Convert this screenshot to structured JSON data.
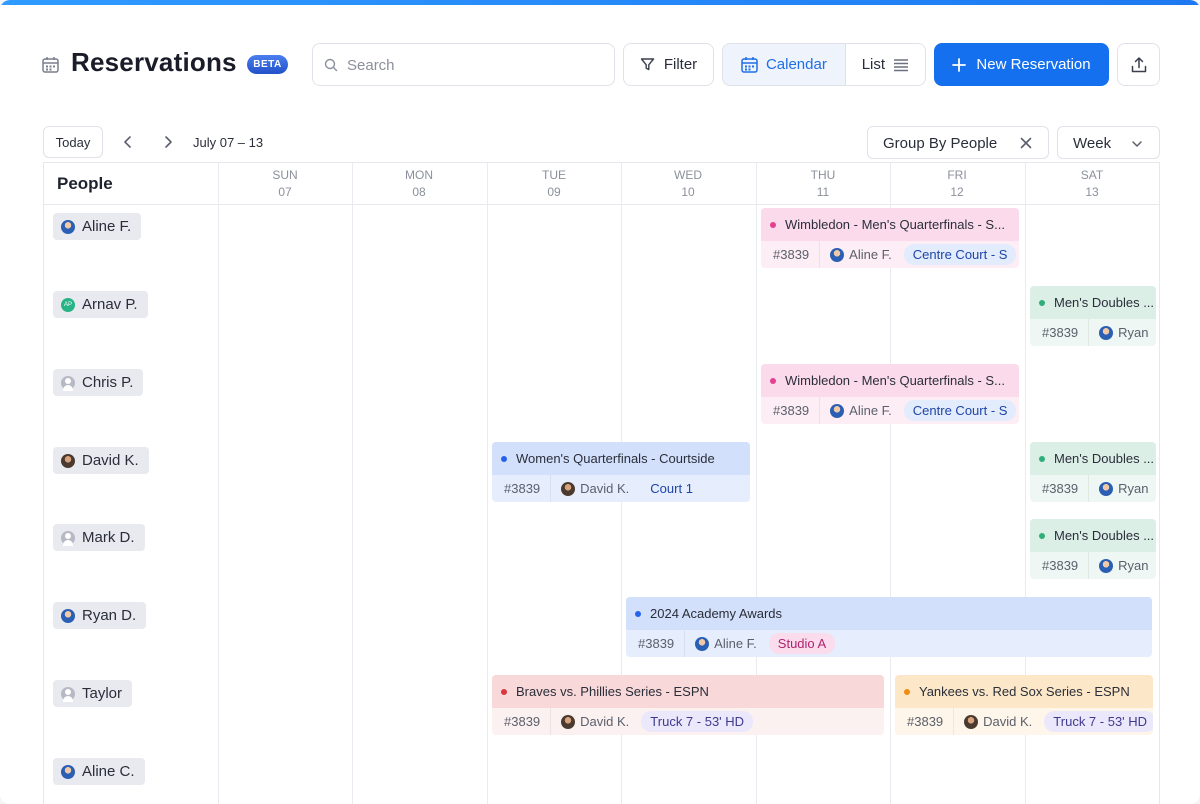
{
  "header": {
    "title": "Reservations",
    "badge": "BETA",
    "search_placeholder": "Search",
    "filter_label": "Filter",
    "view_calendar_label": "Calendar",
    "view_list_label": "List",
    "new_button_label": "New Reservation"
  },
  "toolbar": {
    "today_label": "Today",
    "date_range": "July 07 – 13",
    "group_by_label": "Group By People",
    "range_select_label": "Week"
  },
  "grid": {
    "row_header_label": "People",
    "days": [
      {
        "name": "SUN",
        "num": "07"
      },
      {
        "name": "MON",
        "num": "08"
      },
      {
        "name": "TUE",
        "num": "09"
      },
      {
        "name": "WED",
        "num": "10"
      },
      {
        "name": "THU",
        "num": "11"
      },
      {
        "name": "FRI",
        "num": "12"
      },
      {
        "name": "SAT",
        "num": "13"
      }
    ],
    "people": [
      {
        "name": "Aline F.",
        "avatar": "photo"
      },
      {
        "name": "Arnav P.",
        "avatar": "initials",
        "initials": "AP"
      },
      {
        "name": "Chris P.",
        "avatar": "empty"
      },
      {
        "name": "David K.",
        "avatar": "photo-b"
      },
      {
        "name": "Mark D.",
        "avatar": "empty"
      },
      {
        "name": "Ryan D.",
        "avatar": "photo"
      },
      {
        "name": "Taylor",
        "avatar": "empty"
      },
      {
        "name": "Aline C.",
        "avatar": "photo"
      }
    ]
  },
  "events": [
    {
      "title": "Wimbledon - Men's Quarterfinals - S...",
      "number": "#3839",
      "person": "Aline F.",
      "location": "Centre Court - S",
      "color": "pink"
    },
    {
      "title": "Men's Doubles ...",
      "number": "#3839",
      "person": "Ryan",
      "location": "",
      "color": "green"
    },
    {
      "title": "Wimbledon - Men's Quarterfinals - S...",
      "number": "#3839",
      "person": "Aline F.",
      "location": "Centre Court - S",
      "color": "pink"
    },
    {
      "title": "Women's Quarterfinals - Courtside",
      "number": "#3839",
      "person": "David K.",
      "location": "Court 1",
      "color": "blue"
    },
    {
      "title": "Men's Doubles ...",
      "number": "#3839",
      "person": "Ryan",
      "location": "",
      "color": "green"
    },
    {
      "title": "Men's Doubles ...",
      "number": "#3839",
      "person": "Ryan",
      "location": "",
      "color": "green"
    },
    {
      "title": "2024 Academy Awards",
      "number": "#3839",
      "person": "Aline F.",
      "location": "Studio A",
      "color": "blue"
    },
    {
      "title": "Braves vs. Phillies Series - ESPN",
      "number": "#3839",
      "person": "David K.",
      "location": "Truck 7 - 53' HD",
      "color": "red"
    },
    {
      "title": "Yankees vs. Red Sox Series - ESPN",
      "number": "#3839",
      "person": "David K.",
      "location": "Truck 7 - 53' HD",
      "color": "orange"
    }
  ],
  "colors": {
    "accent": "#1570ef",
    "pink": "#e3418f",
    "green": "#2fae7a",
    "blue": "#2563eb",
    "red": "#d9363e",
    "orange": "#f08c10"
  },
  "icons": [
    "calendar-icon",
    "search-icon",
    "filter-icon",
    "list-icon",
    "plus-icon",
    "export-icon",
    "chevron-left-icon",
    "chevron-right-icon",
    "close-icon",
    "chevron-down-icon"
  ]
}
